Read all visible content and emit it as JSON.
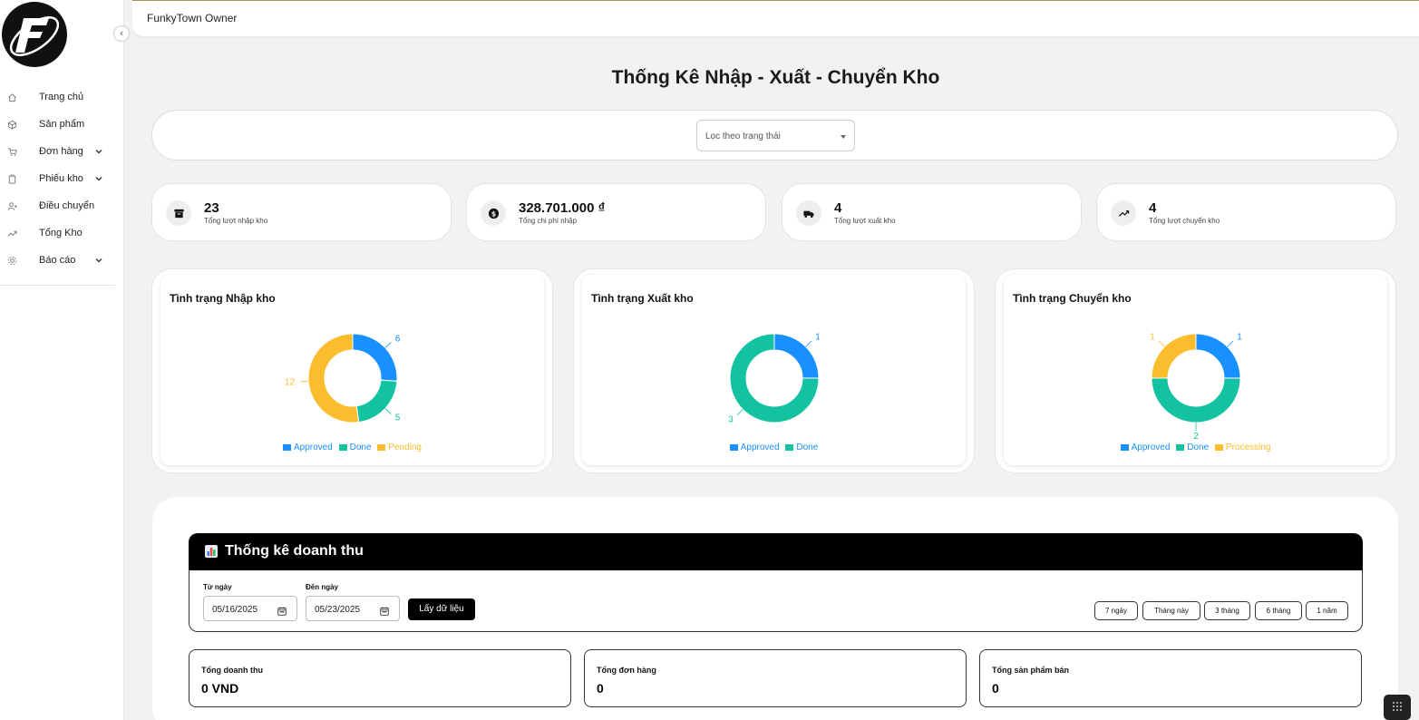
{
  "app": {
    "title": "FunkyTown Owner"
  },
  "sidebar": {
    "items": [
      {
        "label": "Trang chủ",
        "icon": "home-icon",
        "has_chevron": false
      },
      {
        "label": "Sản phẩm",
        "icon": "box-icon",
        "has_chevron": false
      },
      {
        "label": "Đơn hàng",
        "icon": "cart-icon",
        "has_chevron": true
      },
      {
        "label": "Phiếu kho",
        "icon": "clipboard-icon",
        "has_chevron": true
      },
      {
        "label": "Điều chuyển",
        "icon": "user-transfer-icon",
        "has_chevron": false
      },
      {
        "label": "Tổng Kho",
        "icon": "trend-icon",
        "has_chevron": false
      },
      {
        "label": "Báo cáo",
        "icon": "gear-icon",
        "has_chevron": true
      }
    ]
  },
  "page": {
    "title": "Thống Kê Nhập - Xuất - Chuyển Kho"
  },
  "filter": {
    "placeholder": "Lọc theo trạng thái"
  },
  "stats": [
    {
      "value": "23",
      "label": "Tổng lượt nhập kho",
      "icon": "archive-icon"
    },
    {
      "value": "328.701.000 ₫",
      "label": "Tổng chi phí nhập",
      "icon": "dollar-icon"
    },
    {
      "value": "4",
      "label": "Tổng lượt xuất kho",
      "icon": "truck-icon"
    },
    {
      "value": "4",
      "label": "Tổng lượt chuyển kho",
      "icon": "trend-up-icon"
    }
  ],
  "colors": {
    "approved": "#1890ff",
    "done": "#13c2a0",
    "pending": "#fbbc2e",
    "processing": "#fbbc2e"
  },
  "chart_data": [
    {
      "type": "pie",
      "title": "Tình trạng Nhập kho",
      "categories": [
        "Approved",
        "Done",
        "Pending"
      ],
      "values": [
        6,
        5,
        12
      ],
      "legend": "bottom"
    },
    {
      "type": "pie",
      "title": "Tình trạng Xuất kho",
      "categories": [
        "Approved",
        "Done"
      ],
      "values": [
        1,
        3
      ],
      "legend": "bottom"
    },
    {
      "type": "pie",
      "title": "Tình trạng Chuyển kho",
      "categories": [
        "Approved",
        "Done",
        "Processing"
      ],
      "values": [
        1,
        2,
        1
      ],
      "legend": "bottom"
    }
  ],
  "revenue": {
    "title": "Thống kê doanh thu",
    "from_label": "Từ ngày",
    "from_value": "05/16/2025",
    "to_label": "Đến ngày",
    "to_value": "05/23/2025",
    "fetch_button": "Lấy dữ liệu",
    "ranges": [
      "7 ngày",
      "Tháng này",
      "3 tháng",
      "6 tháng",
      "1 năm"
    ],
    "summary": [
      {
        "label": "Tổng doanh thu",
        "value": "0 VND"
      },
      {
        "label": "Tổng đơn hàng",
        "value": "0"
      },
      {
        "label": "Tổng sản phẩm bán",
        "value": "0"
      }
    ]
  }
}
